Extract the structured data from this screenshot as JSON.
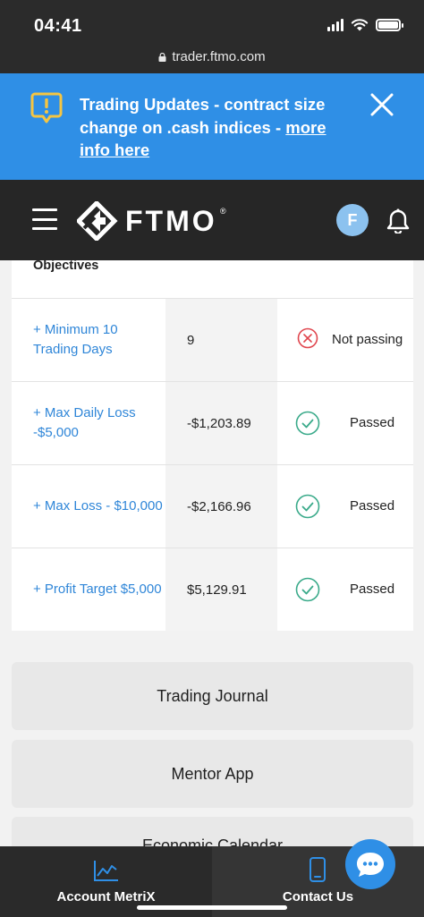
{
  "status_bar": {
    "time": "04:41"
  },
  "browser": {
    "url": "trader.ftmo.com"
  },
  "banner": {
    "text": "Trading Updates - contract size change on .cash indices - ",
    "link": "more info here"
  },
  "nav": {
    "brand": "FTMO",
    "registered": "®",
    "avatar_initial": "F"
  },
  "objectives": {
    "heading": "Objectives",
    "rows": [
      {
        "objective": "+ Minimum 10 Trading Days",
        "value": "9",
        "status": "Not passing",
        "passed": false
      },
      {
        "objective": "+ Max Daily Loss -$5,000",
        "value": "-$1,203.89",
        "status": "Passed",
        "passed": true
      },
      {
        "objective": "+ Max Loss - $10,000",
        "value": "-$2,166.96",
        "status": "Passed",
        "passed": true
      },
      {
        "objective": "+ Profit Target $5,000",
        "value": "$5,129.91",
        "status": "Passed",
        "passed": true
      }
    ]
  },
  "buttons": {
    "trading_journal": "Trading Journal",
    "mentor_app": "Mentor App",
    "third": "Economic Calendar"
  },
  "bottom_nav": {
    "left": "Account MetriX",
    "right": "Contact Us"
  },
  "colors": {
    "accent": "#2f8fe6",
    "link": "#2f86d8",
    "pass": "#3aaa8a",
    "fail": "#e0454d",
    "dark": "#262626"
  }
}
